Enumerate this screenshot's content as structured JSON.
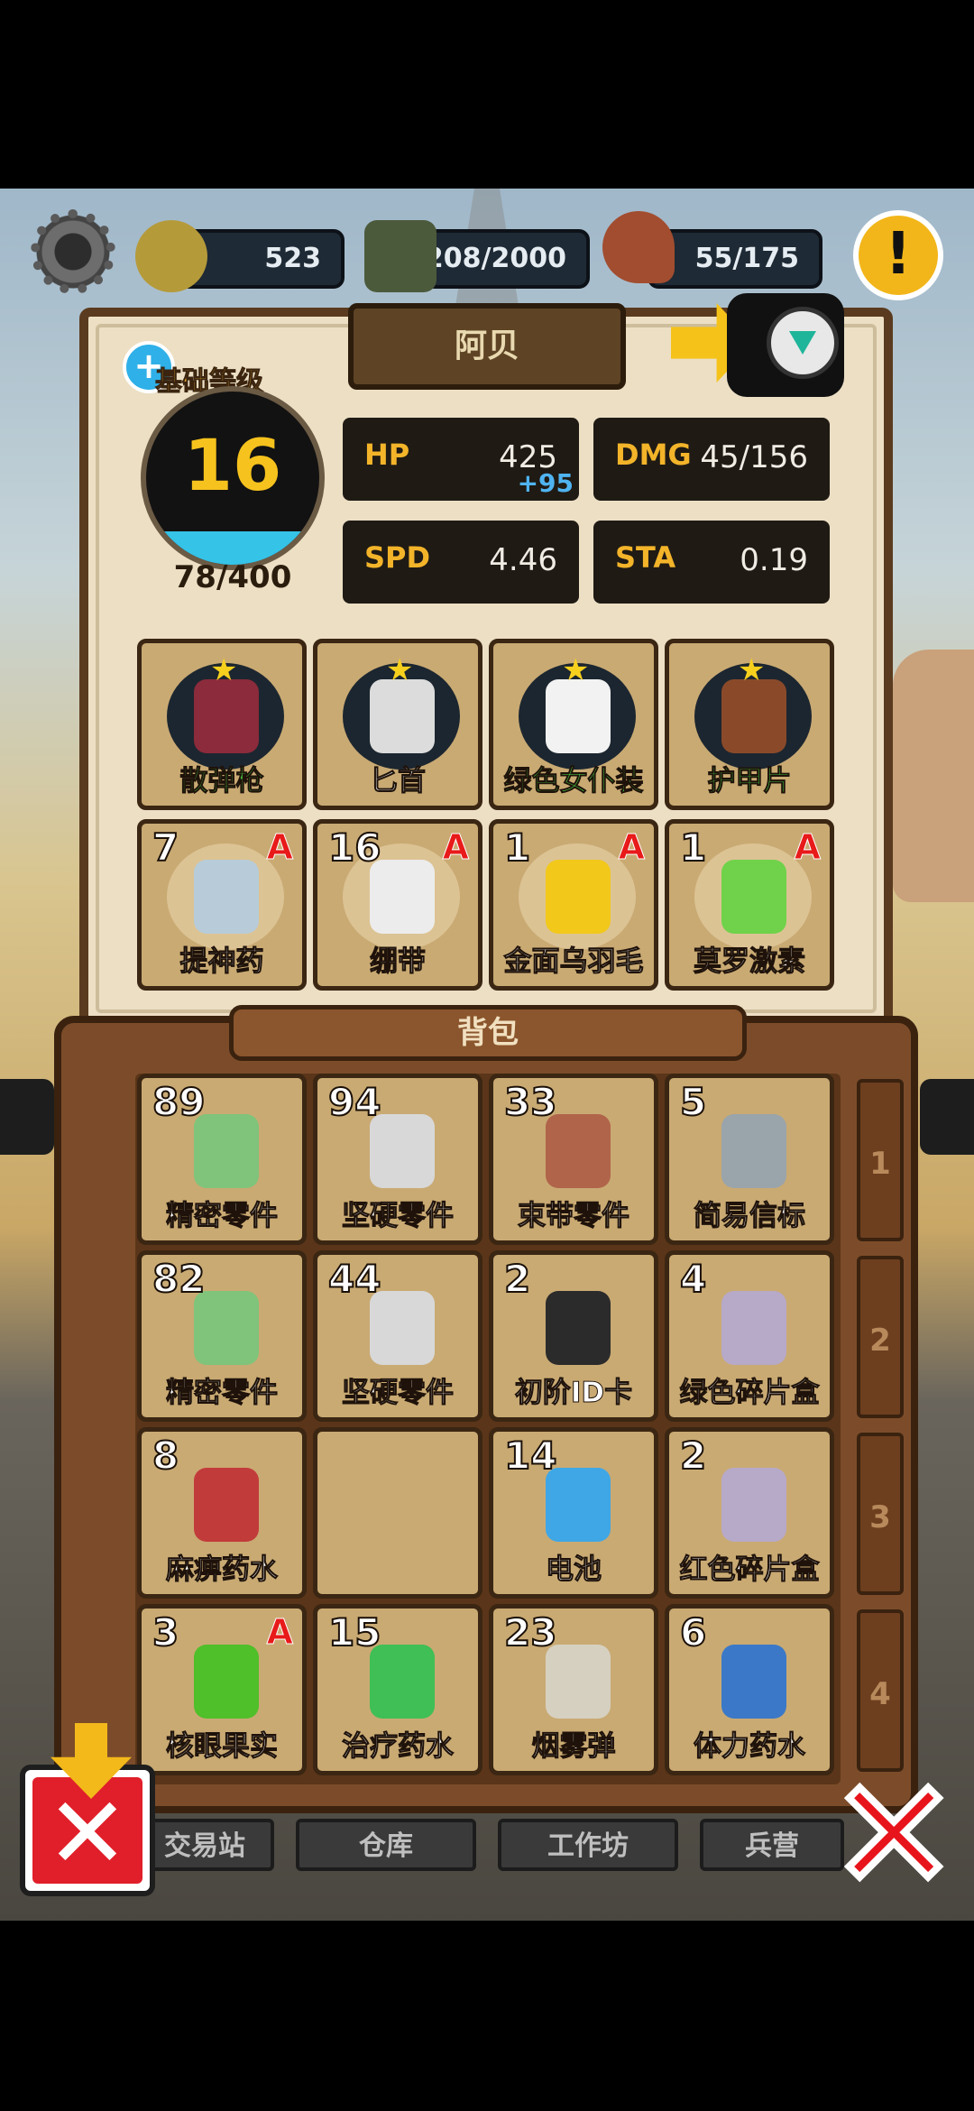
{
  "resources": {
    "nut": "523",
    "crate": "208/2000",
    "meat": "55/175"
  },
  "character": {
    "name": "阿贝",
    "base_level_label": "基础等级",
    "level": "16",
    "exp": "78/400",
    "exp_fraction": 0.195
  },
  "stats": {
    "hp": {
      "key": "HP",
      "value": "425",
      "bonus": "+95"
    },
    "dmg": {
      "key": "DMG",
      "value": "45/156"
    },
    "spd": {
      "key": "SPD",
      "value": "4.46"
    },
    "sta": {
      "key": "STA",
      "value": "0.19"
    }
  },
  "equipment": [
    {
      "label": "散弹枪",
      "color": "#4be34b",
      "icon": "shotgun-icon"
    },
    {
      "label": "匕首",
      "color": "#ffffff",
      "icon": "dagger-icon"
    },
    {
      "label": "绿色女仆装",
      "color": "#4be34b",
      "icon": "maid-outfit-icon"
    },
    {
      "label": "护甲片",
      "color": "#4be34b",
      "icon": "armor-plate-icon"
    }
  ],
  "quick_items": [
    {
      "count": "7",
      "grade": "A",
      "label": "提神药",
      "icon": "potion-bottle-icon"
    },
    {
      "count": "16",
      "grade": "A",
      "label": "绷带",
      "icon": "bandage-icon"
    },
    {
      "count": "1",
      "grade": "A",
      "label": "金面乌羽毛",
      "icon": "feather-icon"
    },
    {
      "count": "1",
      "grade": "A",
      "label": "莫罗激素",
      "icon": "hormone-flask-icon"
    }
  ],
  "backpack": {
    "title": "背包",
    "tabs": [
      "1",
      "2",
      "3",
      "4"
    ],
    "items": [
      {
        "count": "89",
        "grade": "",
        "label": "精密零件",
        "icon": "precision-parts-icon"
      },
      {
        "count": "94",
        "grade": "",
        "label": "坚硬零件",
        "icon": "hard-parts-icon"
      },
      {
        "count": "33",
        "grade": "",
        "label": "束带零件",
        "icon": "strap-parts-icon"
      },
      {
        "count": "5",
        "grade": "",
        "label": "简易信标",
        "icon": "beacon-icon"
      },
      {
        "count": "82",
        "grade": "",
        "label": "精密零件",
        "icon": "precision-parts-icon"
      },
      {
        "count": "44",
        "grade": "",
        "label": "坚硬零件",
        "icon": "hard-parts-icon"
      },
      {
        "count": "2",
        "grade": "",
        "label": "初阶ID卡",
        "icon": "id-card-icon"
      },
      {
        "count": "4",
        "grade": "",
        "label": "绿色碎片盒",
        "icon": "green-shard-box-icon"
      },
      {
        "count": "8",
        "grade": "",
        "label": "麻痹药水",
        "icon": "paralysis-potion-icon"
      },
      {
        "count": "",
        "grade": "",
        "label": "",
        "icon": ""
      },
      {
        "count": "14",
        "grade": "",
        "label": "电池",
        "icon": "battery-icon"
      },
      {
        "count": "2",
        "grade": "",
        "label": "红色碎片盒",
        "icon": "red-shard-box-icon"
      },
      {
        "count": "3",
        "grade": "A",
        "label": "核眼果实",
        "icon": "eye-fruit-icon"
      },
      {
        "count": "15",
        "grade": "",
        "label": "治疗药水",
        "icon": "healing-potion-icon"
      },
      {
        "count": "23",
        "grade": "",
        "label": "烟雾弹",
        "icon": "smoke-bomb-icon"
      },
      {
        "count": "6",
        "grade": "",
        "label": "体力药水",
        "icon": "stamina-potion-icon"
      }
    ]
  },
  "bottom_nav": [
    "交易站",
    "仓库",
    "工作坊",
    "兵营"
  ],
  "alert_symbol": "!"
}
